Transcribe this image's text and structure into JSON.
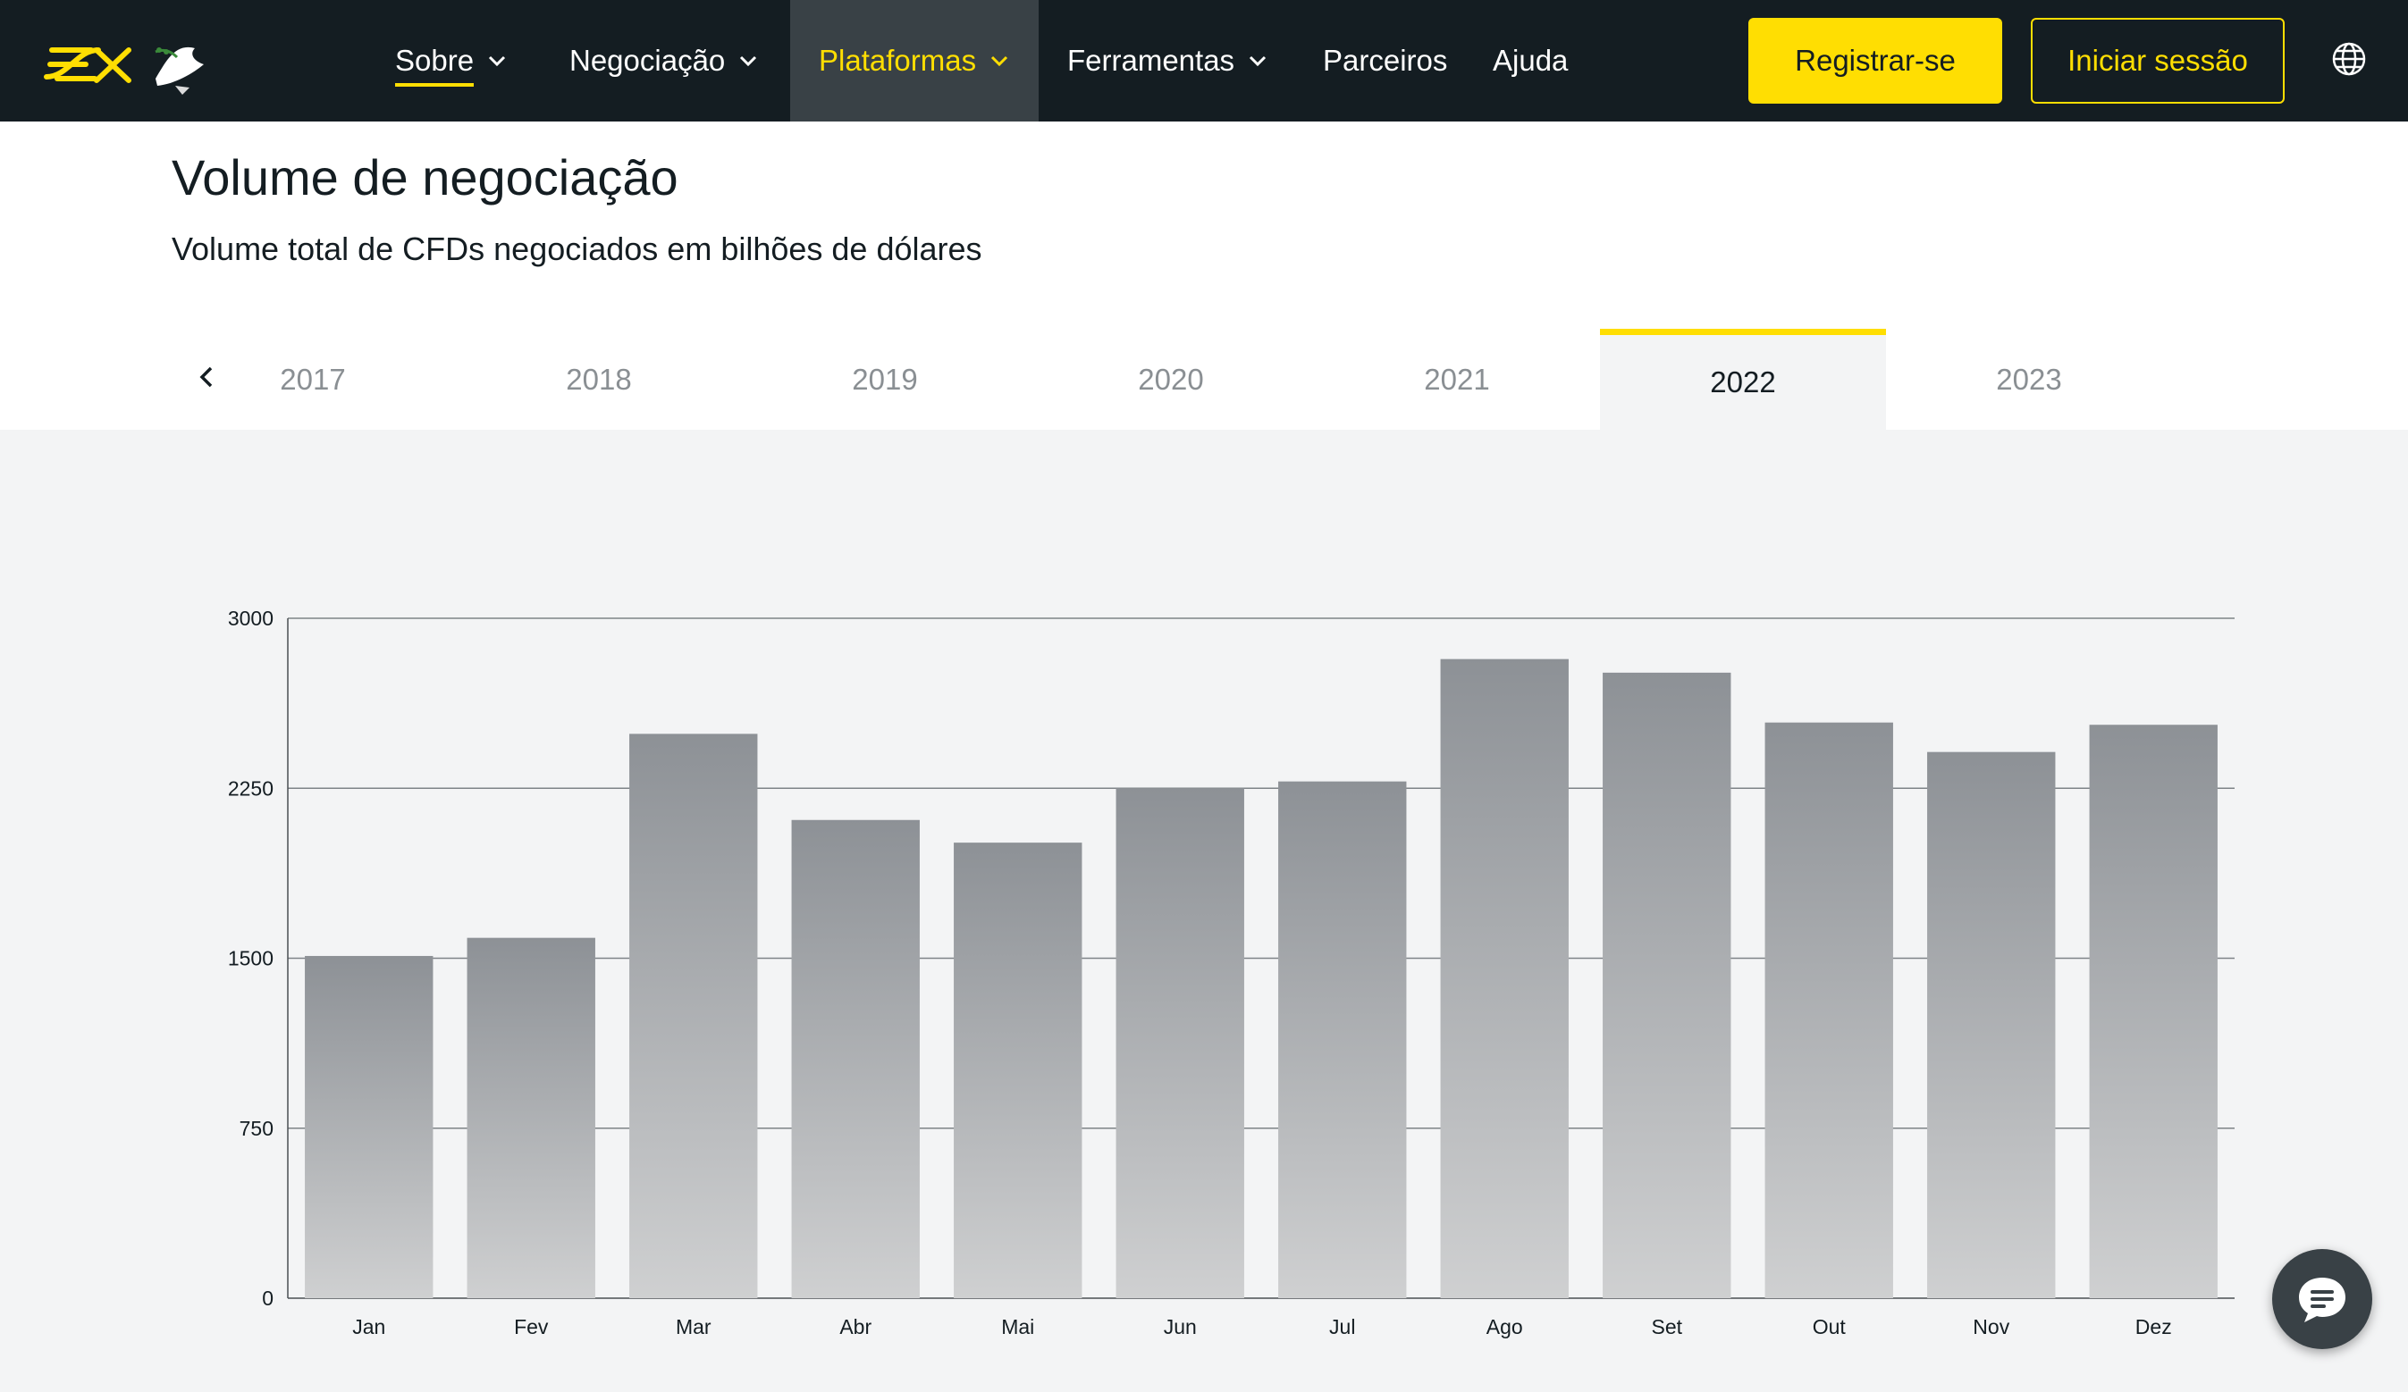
{
  "nav": {
    "items": [
      {
        "label": "Sobre"
      },
      {
        "label": "Negociação"
      },
      {
        "label": "Plataformas"
      },
      {
        "label": "Ferramentas"
      },
      {
        "label": "Parceiros"
      },
      {
        "label": "Ajuda"
      }
    ],
    "register_label": "Registrar-se",
    "login_label": "Iniciar sessão",
    "language_icon": "globe-icon"
  },
  "header": {
    "title": "Volume de negociação",
    "subtitle": "Volume total de CFDs negociados em bilhões de dólares"
  },
  "tabs": {
    "years": [
      "2017",
      "2018",
      "2019",
      "2020",
      "2021",
      "2022",
      "2023"
    ],
    "active": "2022"
  },
  "colors": {
    "nav_bg": "#141d22",
    "accent": "#ffde02",
    "bar_top": "#8d9196",
    "bar_bottom": "#cfd0d1"
  },
  "chart_data": {
    "type": "bar",
    "title": "",
    "xlabel": "",
    "ylabel": "",
    "categories": [
      "Jan",
      "Fev",
      "Mar",
      "Abr",
      "Mai",
      "Jun",
      "Jul",
      "Ago",
      "Set",
      "Out",
      "Nov",
      "Dez"
    ],
    "values": [
      1510,
      1590,
      2490,
      2110,
      2010,
      2250,
      2280,
      2820,
      2760,
      2540,
      2410,
      2530
    ],
    "ylim": [
      0,
      3000
    ],
    "yticks": [
      0,
      750,
      1500,
      2250,
      3000
    ],
    "grid": true,
    "legend": "none"
  }
}
